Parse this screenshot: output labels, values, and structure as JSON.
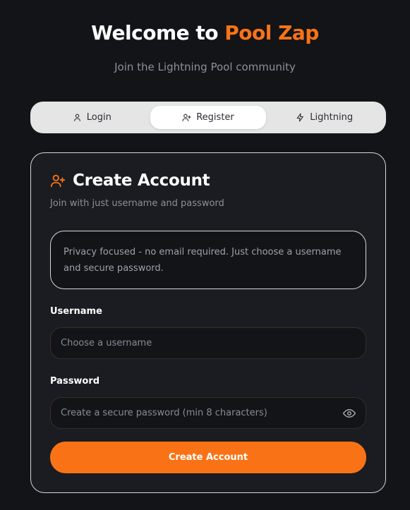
{
  "header": {
    "title_prefix": "Welcome to",
    "title_accent": "Pool Zap",
    "subtitle": "Join the Lightning Pool community"
  },
  "tabs": [
    {
      "label": "Login",
      "icon": "user-icon",
      "active": false
    },
    {
      "label": "Register",
      "icon": "user-plus-icon",
      "active": true
    },
    {
      "label": "Lightning",
      "icon": "lightning-icon",
      "active": false
    }
  ],
  "card": {
    "icon": "user-plus-icon",
    "title": "Create Account",
    "subtitle": "Join with just username and password",
    "notice": "Privacy focused - no email required. Just choose a username and secure password.",
    "username": {
      "label": "Username",
      "placeholder": "Choose a username",
      "value": ""
    },
    "password": {
      "label": "Password",
      "placeholder": "Create a secure password (min 8 characters)",
      "value": "",
      "toggle_icon": "eye-icon"
    },
    "submit_label": "Create Account"
  },
  "colors": {
    "accent": "#f97316",
    "background": "#121418",
    "card": "#1a1c21",
    "tabs_bg": "#e5e5e5"
  }
}
